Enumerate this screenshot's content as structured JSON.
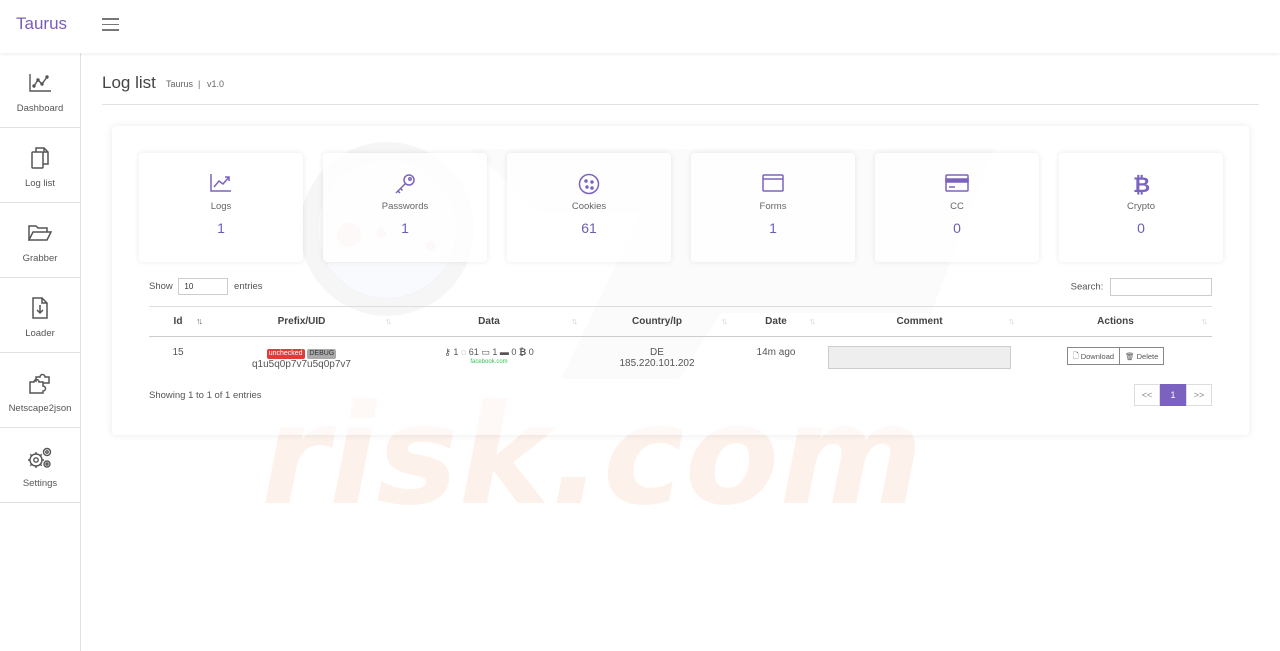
{
  "brand": "Taurus",
  "colors": {
    "accent": "#7b5cb8",
    "stat_value": "#6d5fb0",
    "badge_red": "#e03a3a"
  },
  "sidebar": {
    "items": [
      {
        "label": "Dashboard",
        "icon": "chart-icon"
      },
      {
        "label": "Log list",
        "icon": "copy-icon"
      },
      {
        "label": "Grabber",
        "icon": "folder-open-icon"
      },
      {
        "label": "Loader",
        "icon": "file-download-icon"
      },
      {
        "label": "Netscape2json",
        "icon": "puzzle-icon"
      },
      {
        "label": "Settings",
        "icon": "gears-icon"
      }
    ]
  },
  "header": {
    "title": "Log list",
    "crumb_app": "Taurus",
    "crumb_sep": "|",
    "crumb_version": "v1.0"
  },
  "stats": [
    {
      "label": "Logs",
      "value": "1",
      "icon": "trend-chart-icon"
    },
    {
      "label": "Passwords",
      "value": "1",
      "icon": "key-icon"
    },
    {
      "label": "Cookies",
      "value": "61",
      "icon": "cookie-icon"
    },
    {
      "label": "Forms",
      "value": "1",
      "icon": "window-icon"
    },
    {
      "label": "CC",
      "value": "0",
      "icon": "credit-card-icon"
    },
    {
      "label": "Crypto",
      "value": "0",
      "icon": "bitcoin-icon"
    }
  ],
  "table_controls": {
    "show_label": "Show",
    "show_value": "10",
    "entries_label": "entries",
    "search_label": "Search:"
  },
  "table": {
    "columns": [
      "Id",
      "Prefix/UID",
      "Data",
      "Country/Ip",
      "Date",
      "Comment",
      "Actions"
    ],
    "rows": [
      {
        "id": "15",
        "badge_status": "unchecked",
        "badge_tag": "DEBUG",
        "uid": "q1u5q0p7v7u5q0p7v7",
        "data_passwords": "1",
        "data_cookies": "61",
        "data_forms": "1",
        "data_cc": "0",
        "data_crypto": "0",
        "data_domain": "facebook.com",
        "country": "DE",
        "ip": "185.220.101.202",
        "date": "14m ago",
        "comment": "",
        "download_label": "Download",
        "delete_label": "Delete"
      }
    ]
  },
  "footer": {
    "info": "Showing 1 to 1 of 1 entries",
    "pages": [
      "<<",
      "1",
      ">>"
    ]
  }
}
